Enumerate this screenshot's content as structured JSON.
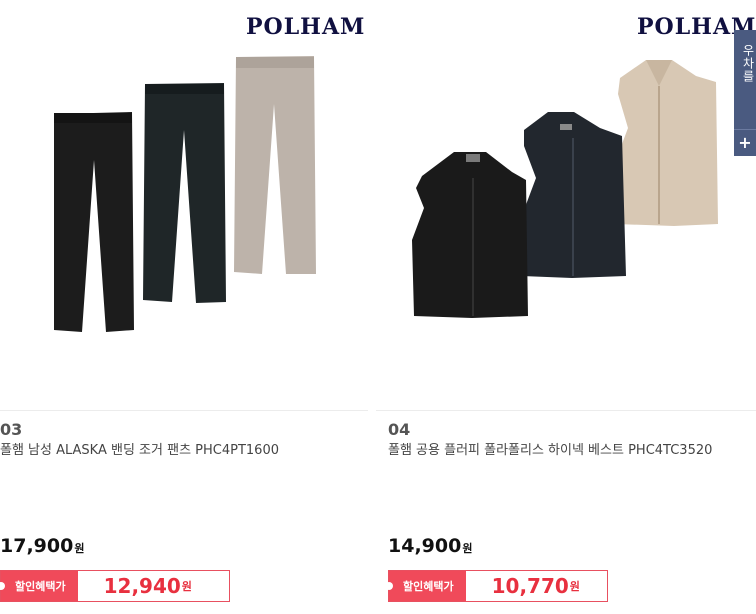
{
  "products": [
    {
      "brand": "POLHAM",
      "rank": "03",
      "name": "폴햄 남성 ALASKA 밴딩 조거 팬츠 PHC4PT1600",
      "price": "17,900",
      "currency": "원",
      "benefit_label": "할인혜택가",
      "sale_price": "12,940",
      "colors": [
        "#1c1c1c",
        "#1f2628",
        "#bdb3aa"
      ]
    },
    {
      "brand": "POLHAM",
      "rank": "04",
      "name": "폴햄 공용 플러피 폴라폴리스 하이넥 베스트 PHC4TC3520",
      "price": "14,900",
      "currency": "원",
      "benefit_label": "할인혜택가",
      "sale_price": "10,770",
      "colors": [
        "#1a1a1a",
        "#22272e",
        "#d8c8b4"
      ]
    }
  ],
  "side_panel": {
    "text": "우차를",
    "plus": "+"
  }
}
